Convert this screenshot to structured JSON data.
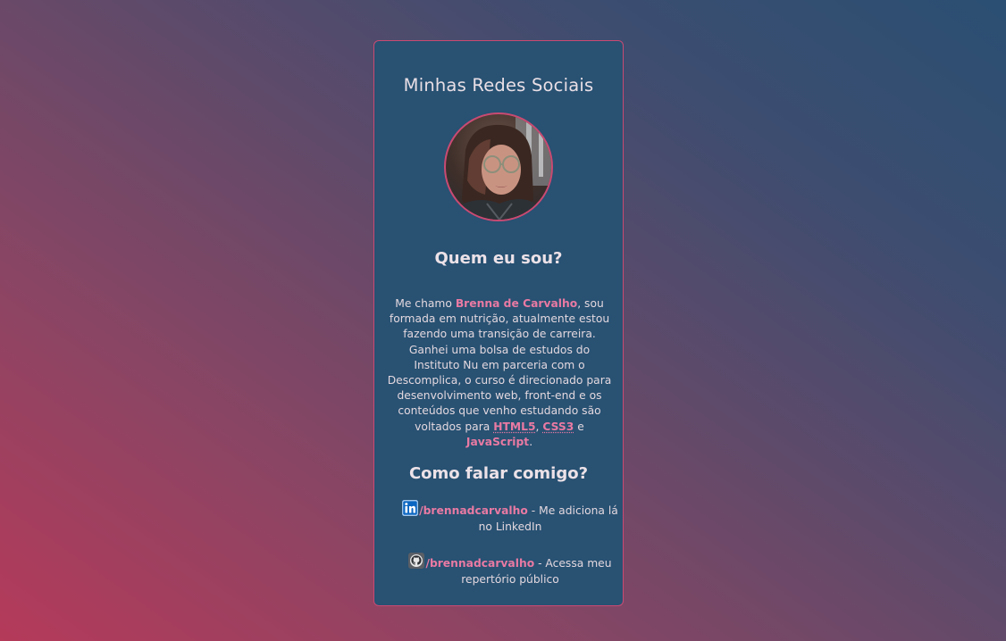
{
  "card": {
    "title": "Minhas Redes Sociais",
    "avatar_icon": "profile-photo"
  },
  "about": {
    "heading": "Quem eu sou?",
    "intro": "Me chamo ",
    "name": "Brenna de Carvalho",
    "sentence1_rest": ", sou formada em nutrição, atualmente estou fazendo uma transição de carreira.",
    "sentence2": " Ganhei uma bolsa de estudos do Instituto Nu em parceria com o Descomplica, o curso é direcionado para desenvolvimento web, front-end e os conteúdos que venho estudando são voltados para ",
    "tech1": "HTML5",
    "sep1": ", ",
    "tech2": "CSS3",
    "sep2": " e ",
    "tech3": "JavaScript",
    "end": "."
  },
  "contact": {
    "heading": "Como falar comigo?",
    "linkedin": {
      "icon": "linkedin-icon",
      "handle": "/brennadcarvalho",
      "desc": " - Me adiciona lá no LinkedIn"
    },
    "github": {
      "icon": "github-icon",
      "handle": "/brennadcarvalho",
      "desc": " - Acessa meu repertório público"
    }
  },
  "colors": {
    "card_bg": "#285172",
    "accent": "#e97aa3",
    "border": "#c94a72"
  }
}
